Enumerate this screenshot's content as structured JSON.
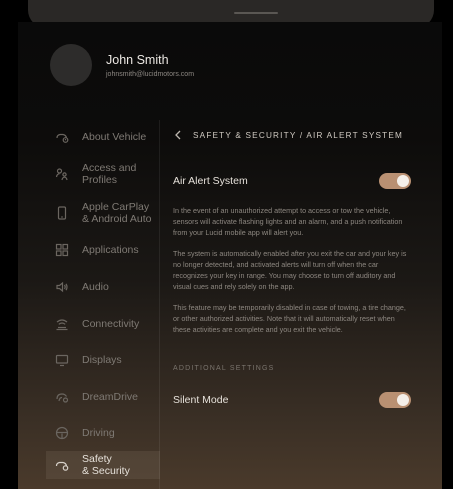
{
  "profile": {
    "name": "John Smith",
    "email": "johnsmith@lucidmotors.com"
  },
  "sidebar": {
    "items": [
      {
        "label": "About Vehicle",
        "icon": "vehicle-info-icon"
      },
      {
        "label": "Access and\nProfiles",
        "icon": "profiles-icon"
      },
      {
        "label": "Apple CarPlay\n& Android Auto",
        "icon": "phone-icon"
      },
      {
        "label": "Applications",
        "icon": "applications-grid-icon"
      },
      {
        "label": "Audio",
        "icon": "speaker-icon"
      },
      {
        "label": "Connectivity",
        "icon": "connectivity-icon"
      },
      {
        "label": "Displays",
        "icon": "display-icon"
      },
      {
        "label": "DreamDrive",
        "icon": "dreamdrive-icon"
      },
      {
        "label": "Driving",
        "icon": "steering-wheel-icon"
      },
      {
        "label": "Safety\n& Security",
        "icon": "safety-car-icon",
        "active": true
      }
    ]
  },
  "main": {
    "breadcrumb": "SAFETY & SECURITY / AIR ALERT SYSTEM",
    "air_alert": {
      "label": "Air Alert System",
      "enabled": true
    },
    "paragraphs": [
      "In the event of an unauthorized attempt to access or tow the vehicle, sensors will activate flashing lights and an alarm, and a push notification from your Lucid mobile app will alert you.",
      "The system is automatically enabled after you exit the car and your key is no longer detected, and activated alerts will turn off when the car recognizes your key in range. You may choose to turn off auditory and visual cues and rely solely on the app.",
      "This feature may be temporarily disabled in case of towing, a tire change, or other authorized activities. Note that it will automatically reset when these activities are complete and you exit the vehicle."
    ],
    "additional_settings_heading": "ADDITIONAL SETTINGS",
    "silent_mode": {
      "label": "Silent Mode",
      "enabled": true
    }
  },
  "colors": {
    "toggle_on": "#b99072",
    "active_item_bg": "#3a322a"
  }
}
